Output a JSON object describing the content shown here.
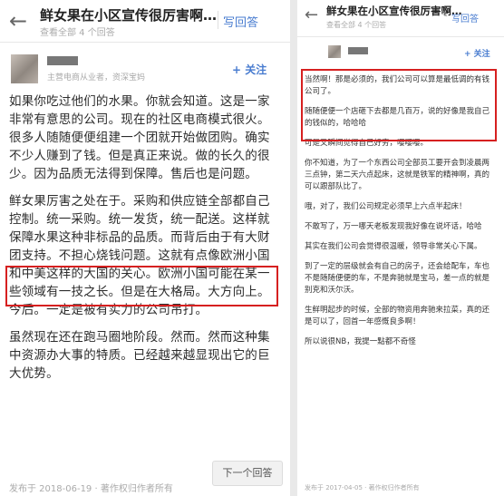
{
  "left": {
    "header": {
      "title": "鲜女果在小区宣传很厉害啊…",
      "subtitle": "查看全部 4 个回答",
      "write_answer": "写回答"
    },
    "author": {
      "description": "主营电商从业者，资深宝妈",
      "follow_label": "+ 关注"
    },
    "paragraphs": [
      "如果你吃过他们的水果。你就会知道。这是一家非常有意思的公司。现在的社区电商模式很火。很多人随随便便组建一个团就开始做团购。确实不少人赚到了钱。但是真正来说。做的长久的很少。因为品质无法得到保障。售后也是问题。",
      "鲜女果厉害之处在于。采购和供应链全部都自己控制。统一采购。统一发货，统一配送。这样就保障水果这种非标品的品质。而背后由于有大财团支持。不担心烧钱问题。这就有点像欧洲小国和中美这样的大国的关心。欧洲小国可能在某一些领域有一技之长。但是在大格局。大方向上。今后。一定是被有实力的公司吊打。",
      "虽然现在还在跑马圈地阶段。然而。然而这种集中资源办大事的特质。已经越来越显现出它的巨大优势。"
    ],
    "footer": "发布于 2018-06-19 · 著作权归作者所有",
    "next_button": "下一个回答"
  },
  "right": {
    "header": {
      "title": "鲜女果在小区宣传很厉害啊…",
      "subtitle": "查看全部 4 个回答",
      "write_answer": "写回答"
    },
    "author": {
      "follow_label": "+ 关注"
    },
    "paragraphs": [
      "当然啊！那是必须的，我们公司可以算是最低调的有钱公司了。",
      "随随便便一个店砸下去都是几百万，说的好像是我自己的钱似的，哈哈哈",
      "可是又瞬间觉得自己好穷，嘤嘤嘤。",
      "你不知道，为了一个东西公司全部员工要开会到凌晨两三点钟，第二天六点起床，这就是铁军的精神啊，真的可以跟部队比了。",
      "哦，对了，我们公司规定必须早上六点半起床！",
      "不敢写了，万一哪天老板发现我好像在说坏话，哈哈",
      "其实在我们公司会觉得很温暖，领导非常关心下属。",
      "到了一定的层级就会有自己的房子，还会给配车，车也不是随随便便的车，不是奔驰就是宝马，差一点的就是别克和沃尔沃。",
      "生鲜明起步的时候，全部的物资用奔驰来拉菜，真的还是可以了，回首一年感慨良多啊！",
      "所以说很NB，我提一點都不奇怪"
    ],
    "footer": "发布于 2017-04-05 · 著作权归作者所有"
  }
}
